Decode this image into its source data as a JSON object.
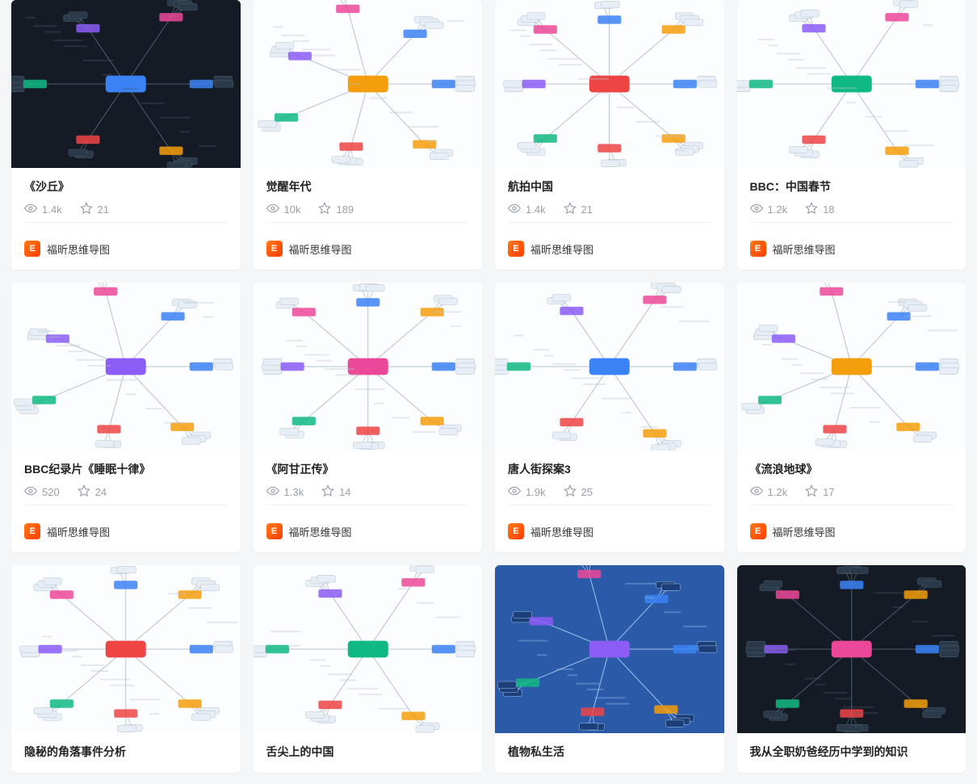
{
  "author": "福昕思维导图",
  "avatar_glyph": "E",
  "cards": [
    {
      "title": "《沙丘》",
      "views": "1.4k",
      "stars": "21",
      "thumb": "dark",
      "showMeta": true
    },
    {
      "title": "觉醒年代",
      "views": "10k",
      "stars": "189",
      "thumb": "light",
      "showMeta": true
    },
    {
      "title": "航拍中国",
      "views": "1.4k",
      "stars": "21",
      "thumb": "light",
      "showMeta": true
    },
    {
      "title": "BBC：中国春节",
      "views": "1.2k",
      "stars": "18",
      "thumb": "light",
      "showMeta": true
    },
    {
      "title": "BBC纪录片《睡眠十律》",
      "views": "520",
      "stars": "24",
      "thumb": "light",
      "showMeta": true
    },
    {
      "title": "《阿甘正传》",
      "views": "1.3k",
      "stars": "14",
      "thumb": "light",
      "showMeta": true
    },
    {
      "title": "唐人街探案3",
      "views": "1.9k",
      "stars": "25",
      "thumb": "light",
      "showMeta": true
    },
    {
      "title": "《流浪地球》",
      "views": "1.2k",
      "stars": "17",
      "thumb": "light",
      "showMeta": true
    },
    {
      "title": "隐秘的角落事件分析",
      "views": "",
      "stars": "",
      "thumb": "light",
      "showMeta": false
    },
    {
      "title": "舌尖上的中国",
      "views": "",
      "stars": "",
      "thumb": "light",
      "showMeta": false
    },
    {
      "title": "植物私生活",
      "views": "",
      "stars": "",
      "thumb": "blue",
      "showMeta": false
    },
    {
      "title": "我从全职奶爸经历中学到的知识",
      "views": "",
      "stars": "",
      "thumb": "dark",
      "showMeta": false
    }
  ]
}
